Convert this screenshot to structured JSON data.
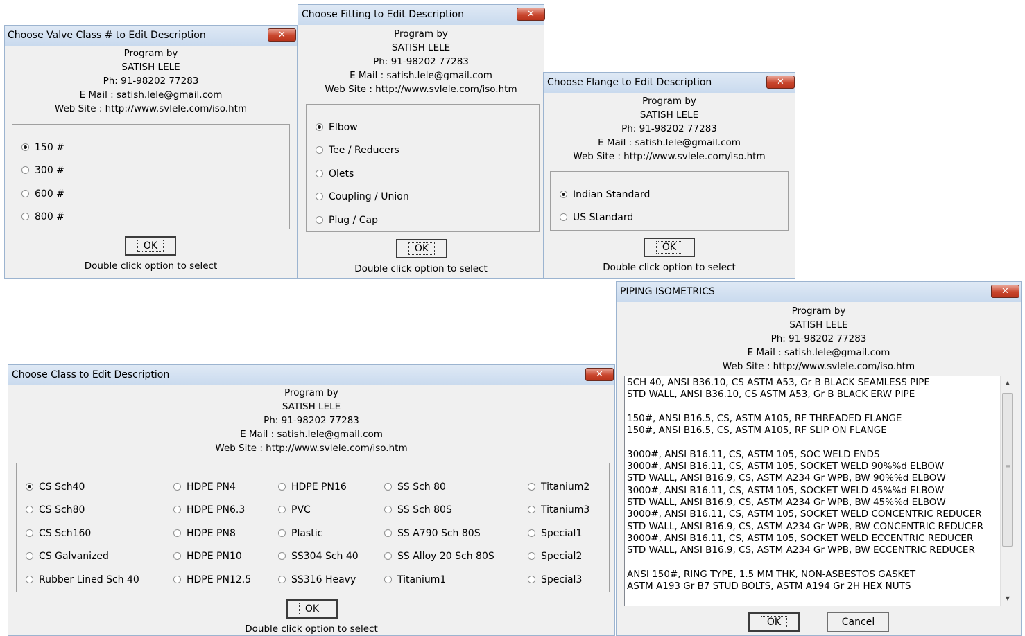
{
  "program_info": {
    "line1": "Program by",
    "line2": "SATISH LELE",
    "line3": "Ph: 91-98202 77283",
    "line4": "E Mail : satish.lele@gmail.com",
    "line5": "Web Site : http://www.svlele.com/iso.htm"
  },
  "valve_dialog": {
    "title": "Choose Valve Class # to Edit Description",
    "close": "✕",
    "options": [
      "150 #",
      "300 #",
      "600 #",
      "800 #"
    ],
    "selected_index": 0,
    "ok_label": "OK",
    "hint": "Double click option to select"
  },
  "fitting_dialog": {
    "title": "Choose Fitting to Edit Description",
    "close": "✕",
    "options": [
      "Elbow",
      "Tee / Reducers",
      "Olets",
      "Coupling / Union",
      "Plug / Cap"
    ],
    "selected_index": 0,
    "ok_label": "OK",
    "hint": "Double click option to select"
  },
  "flange_dialog": {
    "title": "Choose Flange to Edit Description",
    "close": "✕",
    "options": [
      "Indian Standard",
      "US Standard"
    ],
    "selected_index": 0,
    "ok_label": "OK",
    "hint": "Double click option to select"
  },
  "class_dialog": {
    "title": "Choose Class to Edit Description",
    "close": "✕",
    "columns": [
      [
        "CS Sch40",
        "CS Sch80",
        "CS Sch160",
        "CS Galvanized",
        "Rubber Lined Sch 40"
      ],
      [
        "HDPE PN4",
        "HDPE PN6.3",
        "HDPE PN8",
        "HDPE PN10",
        "HDPE PN12.5"
      ],
      [
        "HDPE PN16",
        "PVC",
        "Plastic",
        "SS304 Sch 40",
        "SS316 Heavy"
      ],
      [
        "SS Sch 80",
        "SS Sch 80S",
        "SS A790 Sch 80S",
        "SS Alloy 20 Sch 80S",
        "Titanium1"
      ],
      [
        "Titanium2",
        "Titanium3",
        "Special1",
        "Special2",
        "Special3"
      ]
    ],
    "selected": "CS Sch40",
    "ok_label": "OK",
    "hint": "Double click option to select"
  },
  "iso_dialog": {
    "title": "PIPING ISOMETRICS",
    "close": "✕",
    "description_text": "SCH 40, ANSI B36.10, CS ASTM A53, Gr B BLACK SEAMLESS PIPE\nSTD WALL, ANSI B36.10, CS ASTM A53, Gr B BLACK ERW PIPE\n\n150#, ANSI B16.5, CS, ASTM A105, RF THREADED FLANGE\n150#, ANSI B16.5, CS, ASTM A105, RF SLIP ON FLANGE\n\n3000#, ANSI B16.11, CS, ASTM 105, SOC WELD ENDS\n3000#, ANSI B16.11, CS, ASTM 105, SOCKET WELD 90%%d ELBOW\nSTD WALL, ANSI B16.9, CS, ASTM A234 Gr WPB, BW 90%%d ELBOW\n3000#, ANSI B16.11, CS, ASTM 105, SOCKET WELD 45%%d ELBOW\nSTD WALL, ANSI B16.9, CS, ASTM A234 Gr WPB, BW 45%%d ELBOW\n3000#, ANSI B16.11, CS, ASTM 105, SOCKET WELD CONCENTRIC REDUCER\nSTD WALL, ANSI B16.9, CS, ASTM A234 Gr WPB, BW CONCENTRIC REDUCER\n3000#, ANSI B16.11, CS, ASTM 105, SOCKET WELD ECCENTRIC REDUCER\nSTD WALL, ANSI B16.9, CS, ASTM A234 Gr WPB, BW ECCENTRIC REDUCER\n\nANSI 150#, RING TYPE, 1.5 MM THK, NON-ASBESTOS GASKET\nASTM A193 Gr B7 STUD BOLTS, ASTM A194 Gr 2H HEX NUTS",
    "ok_label": "OK",
    "cancel_label": "Cancel"
  }
}
